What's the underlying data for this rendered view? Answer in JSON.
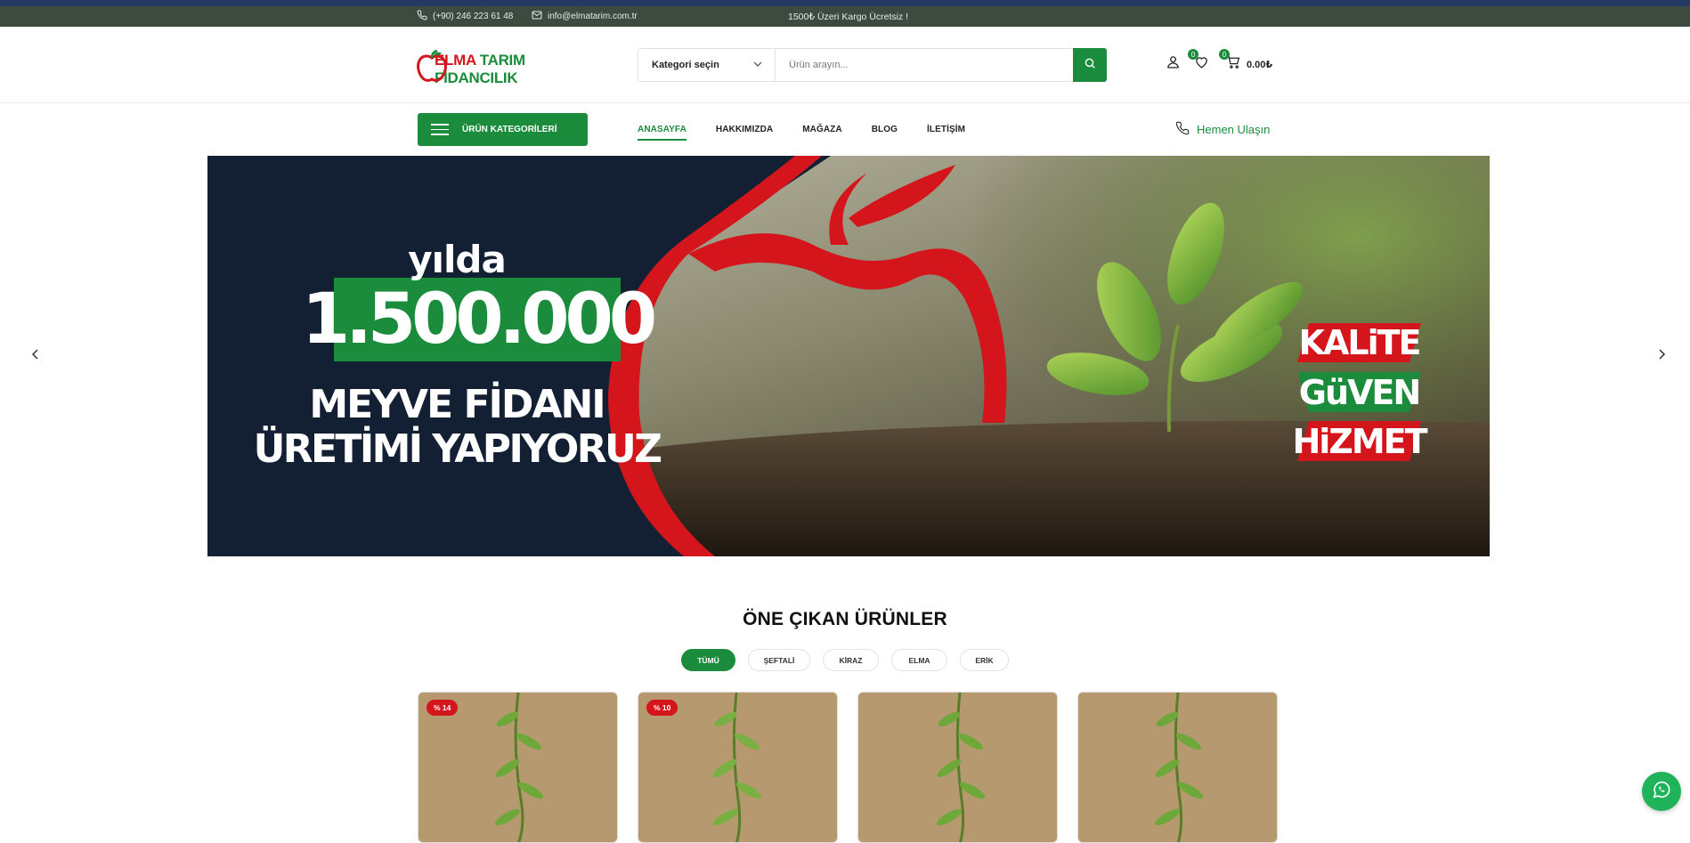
{
  "topbar": {
    "phone": "(+90) 246 223 61 48",
    "email": "info@elmatarim.com.tr",
    "promo": "1500₺ Üzeri Kargo Ücretsiz !"
  },
  "header": {
    "logo_part1": "ELMA",
    "logo_part2": "TARIM FİDANCILIK",
    "category_select": "Kategori seçin",
    "search_placeholder": "Ürün arayın...",
    "wishlist_count": "0",
    "cart_count": "0",
    "cart_total": "0.00₺"
  },
  "nav": {
    "categories_button": "ÜRÜN KATEGORİLERİ",
    "items": [
      "ANASAYFA",
      "HAKKIMIZDA",
      "MAĞAZA",
      "BLOG",
      "İLETİŞİM"
    ],
    "contact_label": "Hemen Ulaşın"
  },
  "hero": {
    "line1": "yılda",
    "number": "1.500.000",
    "line2": "MEYVE FİDANI",
    "line3": "ÜRETİMİ YAPIYORUZ",
    "tags": [
      "KALiTE",
      "GüVEN",
      "HiZMET"
    ]
  },
  "featured": {
    "title": "ÖNE ÇIKAN ÜRÜNLER",
    "filters": [
      "TÜMÜ",
      "ŞEFTALİ",
      "KİRAZ",
      "ELMA",
      "ERİK"
    ],
    "active_filter": "TÜMÜ",
    "discounts": [
      "% 14",
      "% 10"
    ]
  },
  "colors": {
    "brand_green": "#1a8c3b",
    "brand_red": "#d4151c",
    "topbar_bg": "#3c4a3f",
    "hero_dark": "#132033"
  }
}
